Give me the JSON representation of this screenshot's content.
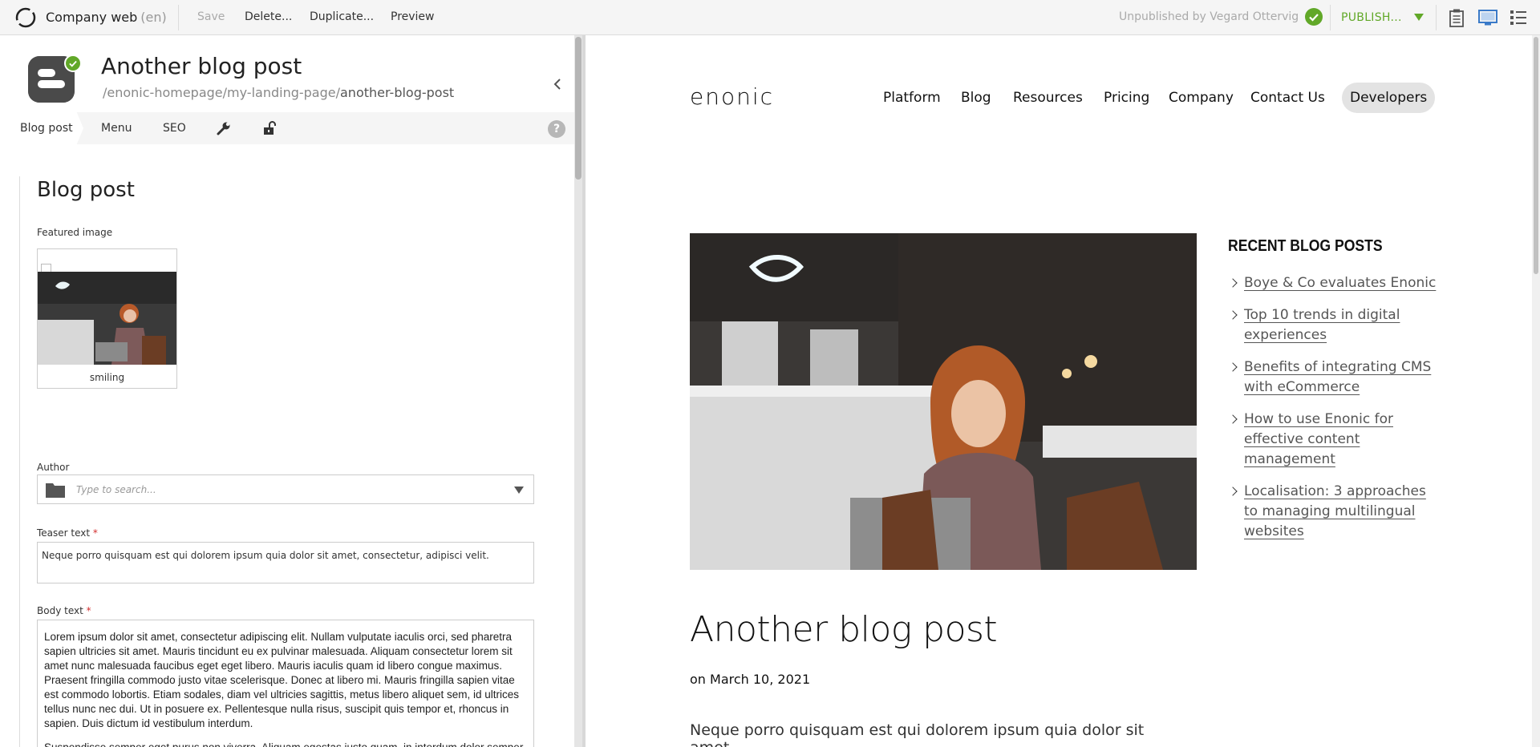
{
  "toolbar": {
    "app_name": "Company web",
    "app_lang": "(en)",
    "save": "Save",
    "delete": "Delete...",
    "duplicate": "Duplicate...",
    "preview": "Preview",
    "status": "Unpublished by Vegard Ottervig",
    "publish": "PUBLISH...",
    "accent_color": "#61a828"
  },
  "content": {
    "title": "Another blog post",
    "path_prefix": "/enonic-homepage/my-landing-page/",
    "path_name": "another-blog-post",
    "tabs": [
      "Blog post",
      "Menu",
      "SEO"
    ],
    "help": "?"
  },
  "form": {
    "section": "Blog post",
    "featured_label": "Featured image",
    "image_caption": "smiling",
    "author_label": "Author",
    "author_placeholder": "Type to search...",
    "teaser_label": "Teaser text",
    "teaser_value": "Neque porro quisquam est qui dolorem ipsum quia dolor sit amet, consectetur, adipisci velit.",
    "body_label": "Body text",
    "required_mark": "*",
    "body_p1": "Lorem ipsum dolor sit amet, consectetur adipiscing elit. Nullam vulputate iaculis orci, sed pharetra sapien ultricies sit amet. Mauris tincidunt eu ex pulvinar malesuada. Aliquam consectetur lorem sit amet nunc malesuada faucibus eget eget libero. Mauris iaculis quam id libero congue maximus. Praesent fringilla commodo justo vitae scelerisque. Donec at libero mi. Mauris fringilla sapien vitae est commodo lobortis. Etiam sodales, diam vel ultricies sagittis, metus libero aliquet sem, id ultrices tellus nunc nec dui. Ut in posuere ex. Pellentesque nulla risus, suscipit quis tempor et, rhoncus in sapien. Duis dictum id vestibulum interdum.",
    "body_p2": "Suspendisse semper eget purus non viverra. Aliquam egestas justo quam, in interdum dolor semper nec. Sed ac condimentum nisl. Vestibulum eleifend, risus sit amet malesuada imperdiet, nibh nisi aliquam enim, sit amet malesuada lectus velit ut ipsum. Sed eget sem pharetra, lobortis"
  },
  "site": {
    "logo": "enonic",
    "nav": [
      "Platform",
      "Blog",
      "Resources",
      "Pricing",
      "Company",
      "Contact Us",
      "Developers"
    ],
    "post_title": "Another blog post",
    "post_date": "on March 10, 2021",
    "post_lead": "Neque porro quisquam est qui dolorem ipsum quia dolor sit amet,",
    "sidebar_title": "RECENT BLOG POSTS",
    "recent": [
      "Boye & Co evaluates Enonic",
      "Top 10 trends in digital experiences",
      "Benefits of integrating CMS with eCommerce",
      "How to use Enonic for effective content management",
      "Localisation: 3 approaches to managing multilingual websites"
    ]
  }
}
